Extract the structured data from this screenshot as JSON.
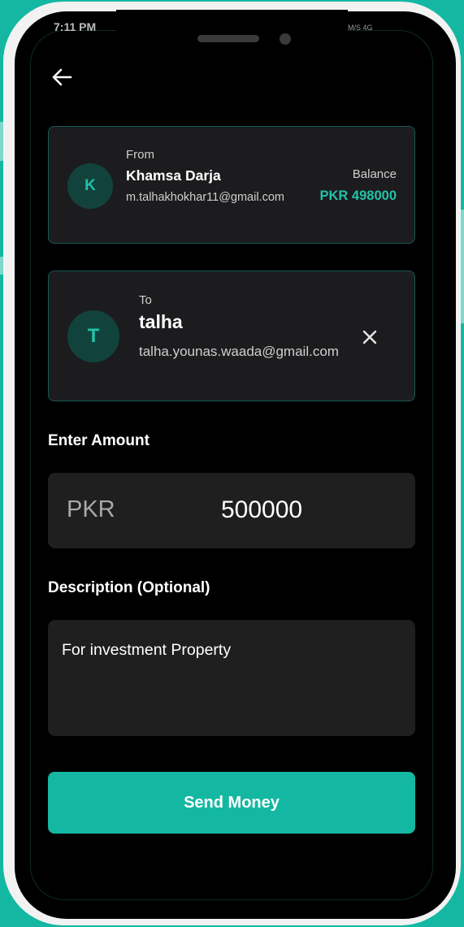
{
  "status_bar": {
    "time": "7:11 PM",
    "indicators": "M/S 4G"
  },
  "from_card": {
    "label": "From",
    "avatar_initial": "K",
    "name": "Khamsa Darja",
    "email": "m.talhakhokhar11@gmail.com",
    "balance_label": "Balance",
    "balance_value": "PKR 498000"
  },
  "to_card": {
    "label": "To",
    "avatar_initial": "T",
    "name": "talha",
    "email": "talha.younas.waada@gmail.com"
  },
  "amount": {
    "label": "Enter Amount",
    "currency": "PKR",
    "value": "500000"
  },
  "description": {
    "label": "Description (Optional)",
    "value": "For investment Property"
  },
  "send_button_label": "Send Money",
  "icons": {
    "back": "arrow-left-icon",
    "clear_recipient": "close-icon"
  },
  "colors": {
    "accent": "#14b8a2",
    "accent_text": "#21c2a8",
    "card_border": "#135a51",
    "card_bg": "#1c1c1e",
    "field_bg": "#1f1f1f",
    "screen_bg": "#000000"
  }
}
